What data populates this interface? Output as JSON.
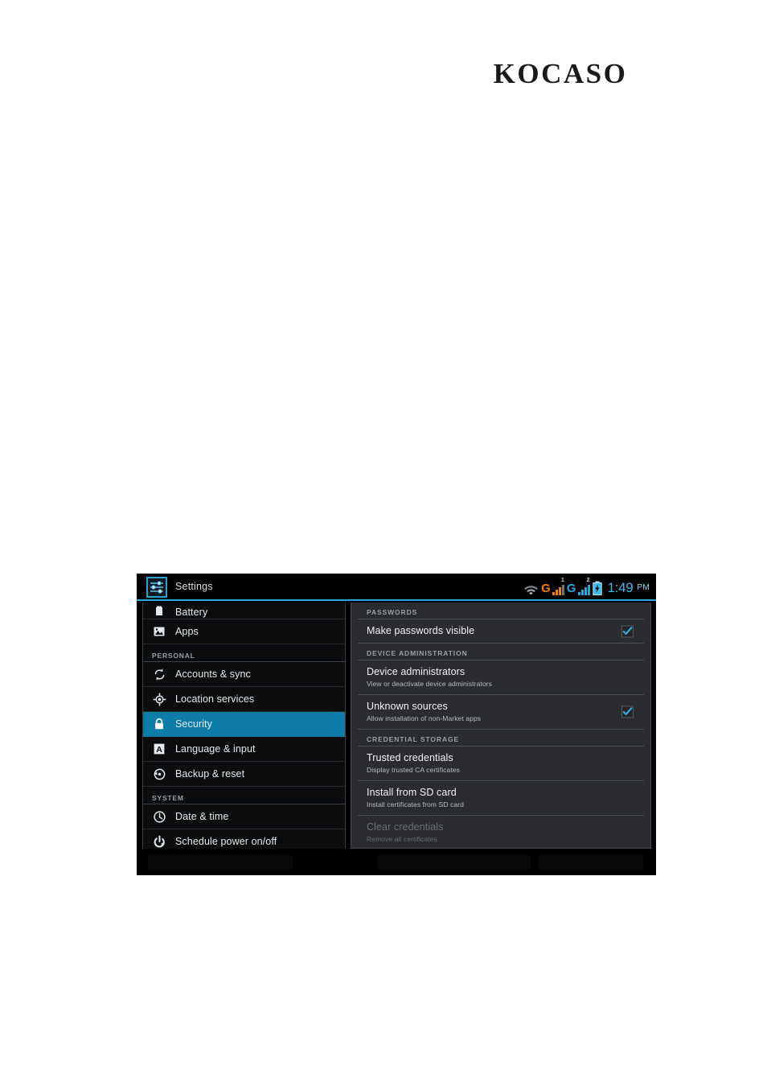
{
  "brand": {
    "logo_text": "KOCASO"
  },
  "tablet": {
    "titlebar": {
      "app_icon": "settings-sliders-icon",
      "app_title": "Settings"
    },
    "statusbar": {
      "wifi_icon": "wifi-icon",
      "sim1": {
        "network_label": "G",
        "slot_number": "1",
        "signal_bars": 3
      },
      "sim2": {
        "network_label": "G",
        "slot_number": "2",
        "signal_bars": 4
      },
      "battery_icon": "battery-charging-icon",
      "time": "1:49",
      "ampm": "PM"
    },
    "sidebar": {
      "items": [
        {
          "label": "Battery",
          "icon": "battery-icon",
          "type": "item",
          "selected": false,
          "clipped": true
        },
        {
          "label": "Apps",
          "icon": "apps-image-icon",
          "type": "item",
          "selected": false,
          "clipped": false
        },
        {
          "label": "PERSONAL",
          "icon": "",
          "type": "section",
          "selected": false,
          "clipped": false
        },
        {
          "label": "Accounts & sync",
          "icon": "sync-icon",
          "type": "item",
          "selected": false,
          "clipped": false
        },
        {
          "label": "Location services",
          "icon": "location-icon",
          "type": "item",
          "selected": false,
          "clipped": false
        },
        {
          "label": "Security",
          "icon": "lock-icon",
          "type": "item",
          "selected": true,
          "clipped": false
        },
        {
          "label": "Language & input",
          "icon": "language-a-icon",
          "type": "item",
          "selected": false,
          "clipped": false
        },
        {
          "label": "Backup & reset",
          "icon": "backup-reset-icon",
          "type": "item",
          "selected": false,
          "clipped": false
        },
        {
          "label": "SYSTEM",
          "icon": "",
          "type": "section",
          "selected": false,
          "clipped": false
        },
        {
          "label": "Date & time",
          "icon": "clock-icon",
          "type": "item",
          "selected": false,
          "clipped": false
        },
        {
          "label": "Schedule power on/off",
          "icon": "power-icon",
          "type": "item",
          "selected": false,
          "clipped": false
        }
      ]
    },
    "detail": {
      "sections": [
        {
          "header": "PASSWORDS",
          "rows": [
            {
              "title": "Make passwords visible",
              "subtitle": "",
              "checkbox": true,
              "checked": true,
              "disabled": false
            }
          ]
        },
        {
          "header": "DEVICE ADMINISTRATION",
          "rows": [
            {
              "title": "Device administrators",
              "subtitle": "View or deactivate device administrators",
              "checkbox": false,
              "checked": false,
              "disabled": false
            },
            {
              "title": "Unknown sources",
              "subtitle": "Allow installation of non-Market apps",
              "checkbox": true,
              "checked": true,
              "disabled": false
            }
          ]
        },
        {
          "header": "CREDENTIAL STORAGE",
          "rows": [
            {
              "title": "Trusted credentials",
              "subtitle": "Display trusted CA certificates",
              "checkbox": false,
              "checked": false,
              "disabled": false
            },
            {
              "title": "Install from SD card",
              "subtitle": "Install certificates from SD card",
              "checkbox": false,
              "checked": false,
              "disabled": false
            },
            {
              "title": "Clear credentials",
              "subtitle": "Remove all certificates",
              "checkbox": false,
              "checked": false,
              "disabled": true
            }
          ]
        }
      ]
    }
  },
  "colors": {
    "accent_selected": "#0d7ca8",
    "accent_divider": "#2aa6d8",
    "sim1": "#f07c16",
    "sim2": "#2aa6d8",
    "clock": "#3fb7e8",
    "sidebar_bg": "#0b0c0d",
    "detail_bg": "#2a2c30",
    "page_bg": "#ffffff"
  }
}
